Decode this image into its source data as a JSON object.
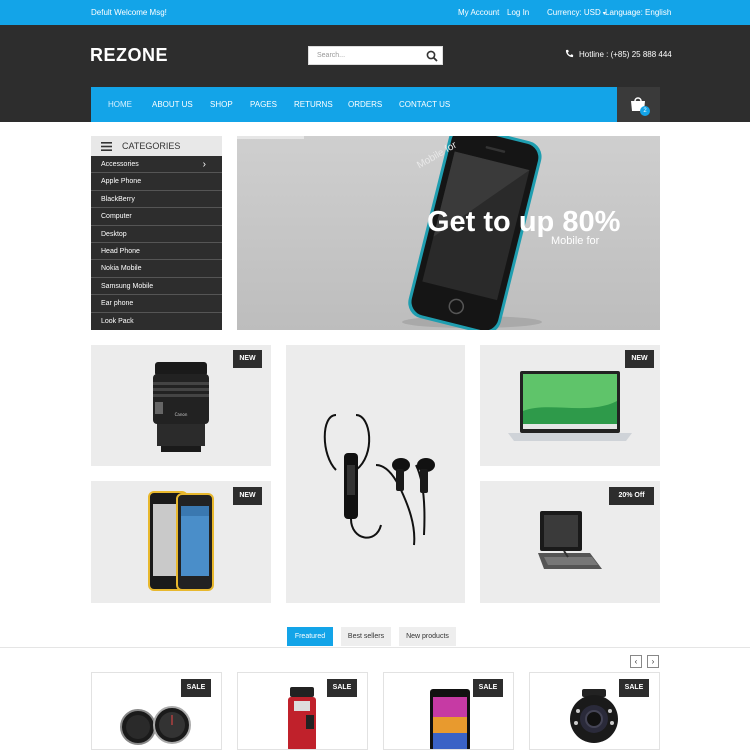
{
  "topbar": {
    "welcome": "Defult Welcome Msg!",
    "my_account": "My Account",
    "login": "Log In",
    "currency": "Currency: USD",
    "language": "Language: English"
  },
  "header": {
    "logo": "REZONE",
    "search_placeholder": "Search...",
    "hotline": "Hotline : (+85) 25 888 444"
  },
  "nav": {
    "items": [
      "HOME",
      "ABOUT US",
      "SHOP",
      "PAGES",
      "RETURNS",
      "ORDERS",
      "CONTACT US"
    ],
    "cart_count": "2"
  },
  "categories": {
    "title": "CATEGORIES",
    "items": [
      "Accessories",
      "Apple Phone",
      "BlackBerry",
      "Computer",
      "Desktop",
      "Head Phone",
      "Nokia Mobile",
      "Samsung Mobile",
      "Ear phone",
      "Look Pack"
    ]
  },
  "banner": {
    "headline": "Get to up 80%",
    "subline": "Mobile for",
    "rotated": "Mobile for"
  },
  "tiles": {
    "camera_badge": "NEW",
    "laptop_badge": "NEW",
    "phone_badge": "NEW",
    "tablet_badge": "20% Off"
  },
  "product_tabs": [
    "Freatured",
    "Best sellers",
    "New products"
  ],
  "arrows": {
    "prev": "‹",
    "next": "›"
  },
  "products": {
    "badges": [
      "SALE",
      "SALE",
      "SALE",
      "SALE"
    ]
  },
  "colors": {
    "accent": "#13a4e8",
    "dark": "#2d2d2d",
    "tile": "#ececec"
  }
}
